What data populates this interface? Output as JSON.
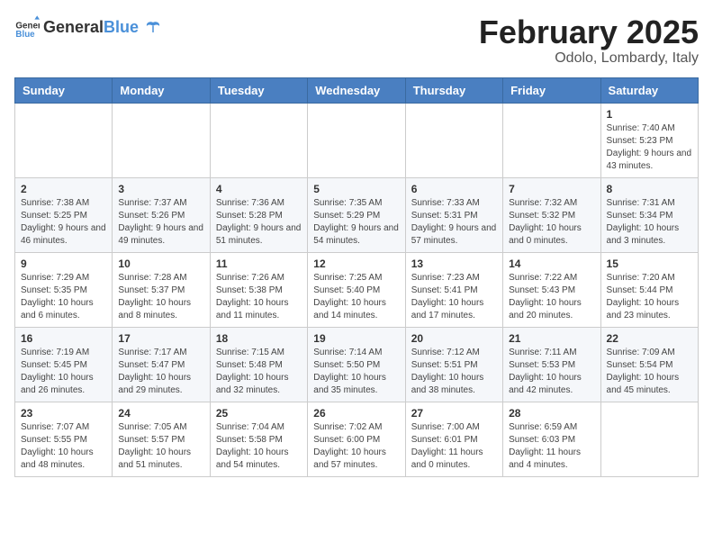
{
  "header": {
    "logo_general": "General",
    "logo_blue": "Blue",
    "title": "February 2025",
    "subtitle": "Odolo, Lombardy, Italy"
  },
  "days_of_week": [
    "Sunday",
    "Monday",
    "Tuesday",
    "Wednesday",
    "Thursday",
    "Friday",
    "Saturday"
  ],
  "weeks": [
    [
      {
        "day": "",
        "info": ""
      },
      {
        "day": "",
        "info": ""
      },
      {
        "day": "",
        "info": ""
      },
      {
        "day": "",
        "info": ""
      },
      {
        "day": "",
        "info": ""
      },
      {
        "day": "",
        "info": ""
      },
      {
        "day": "1",
        "info": "Sunrise: 7:40 AM\nSunset: 5:23 PM\nDaylight: 9 hours and 43 minutes."
      }
    ],
    [
      {
        "day": "2",
        "info": "Sunrise: 7:38 AM\nSunset: 5:25 PM\nDaylight: 9 hours and 46 minutes."
      },
      {
        "day": "3",
        "info": "Sunrise: 7:37 AM\nSunset: 5:26 PM\nDaylight: 9 hours and 49 minutes."
      },
      {
        "day": "4",
        "info": "Sunrise: 7:36 AM\nSunset: 5:28 PM\nDaylight: 9 hours and 51 minutes."
      },
      {
        "day": "5",
        "info": "Sunrise: 7:35 AM\nSunset: 5:29 PM\nDaylight: 9 hours and 54 minutes."
      },
      {
        "day": "6",
        "info": "Sunrise: 7:33 AM\nSunset: 5:31 PM\nDaylight: 9 hours and 57 minutes."
      },
      {
        "day": "7",
        "info": "Sunrise: 7:32 AM\nSunset: 5:32 PM\nDaylight: 10 hours and 0 minutes."
      },
      {
        "day": "8",
        "info": "Sunrise: 7:31 AM\nSunset: 5:34 PM\nDaylight: 10 hours and 3 minutes."
      }
    ],
    [
      {
        "day": "9",
        "info": "Sunrise: 7:29 AM\nSunset: 5:35 PM\nDaylight: 10 hours and 6 minutes."
      },
      {
        "day": "10",
        "info": "Sunrise: 7:28 AM\nSunset: 5:37 PM\nDaylight: 10 hours and 8 minutes."
      },
      {
        "day": "11",
        "info": "Sunrise: 7:26 AM\nSunset: 5:38 PM\nDaylight: 10 hours and 11 minutes."
      },
      {
        "day": "12",
        "info": "Sunrise: 7:25 AM\nSunset: 5:40 PM\nDaylight: 10 hours and 14 minutes."
      },
      {
        "day": "13",
        "info": "Sunrise: 7:23 AM\nSunset: 5:41 PM\nDaylight: 10 hours and 17 minutes."
      },
      {
        "day": "14",
        "info": "Sunrise: 7:22 AM\nSunset: 5:43 PM\nDaylight: 10 hours and 20 minutes."
      },
      {
        "day": "15",
        "info": "Sunrise: 7:20 AM\nSunset: 5:44 PM\nDaylight: 10 hours and 23 minutes."
      }
    ],
    [
      {
        "day": "16",
        "info": "Sunrise: 7:19 AM\nSunset: 5:45 PM\nDaylight: 10 hours and 26 minutes."
      },
      {
        "day": "17",
        "info": "Sunrise: 7:17 AM\nSunset: 5:47 PM\nDaylight: 10 hours and 29 minutes."
      },
      {
        "day": "18",
        "info": "Sunrise: 7:15 AM\nSunset: 5:48 PM\nDaylight: 10 hours and 32 minutes."
      },
      {
        "day": "19",
        "info": "Sunrise: 7:14 AM\nSunset: 5:50 PM\nDaylight: 10 hours and 35 minutes."
      },
      {
        "day": "20",
        "info": "Sunrise: 7:12 AM\nSunset: 5:51 PM\nDaylight: 10 hours and 38 minutes."
      },
      {
        "day": "21",
        "info": "Sunrise: 7:11 AM\nSunset: 5:53 PM\nDaylight: 10 hours and 42 minutes."
      },
      {
        "day": "22",
        "info": "Sunrise: 7:09 AM\nSunset: 5:54 PM\nDaylight: 10 hours and 45 minutes."
      }
    ],
    [
      {
        "day": "23",
        "info": "Sunrise: 7:07 AM\nSunset: 5:55 PM\nDaylight: 10 hours and 48 minutes."
      },
      {
        "day": "24",
        "info": "Sunrise: 7:05 AM\nSunset: 5:57 PM\nDaylight: 10 hours and 51 minutes."
      },
      {
        "day": "25",
        "info": "Sunrise: 7:04 AM\nSunset: 5:58 PM\nDaylight: 10 hours and 54 minutes."
      },
      {
        "day": "26",
        "info": "Sunrise: 7:02 AM\nSunset: 6:00 PM\nDaylight: 10 hours and 57 minutes."
      },
      {
        "day": "27",
        "info": "Sunrise: 7:00 AM\nSunset: 6:01 PM\nDaylight: 11 hours and 0 minutes."
      },
      {
        "day": "28",
        "info": "Sunrise: 6:59 AM\nSunset: 6:03 PM\nDaylight: 11 hours and 4 minutes."
      },
      {
        "day": "",
        "info": ""
      }
    ]
  ]
}
